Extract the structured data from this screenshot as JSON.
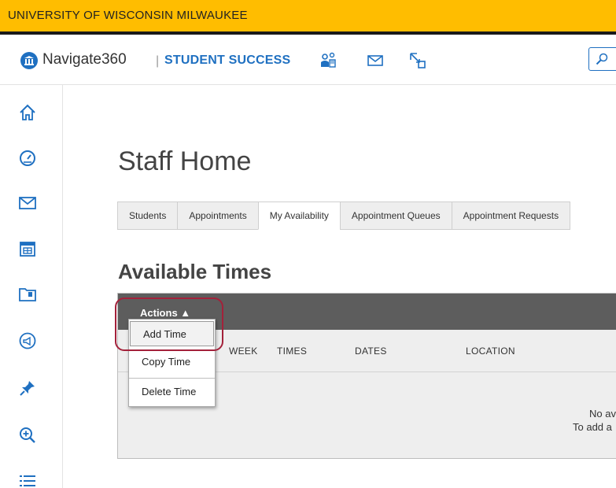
{
  "university_bar": {
    "name": "UNIVERSITY OF WISCONSIN MILWAUKEE",
    "color": "#ffbd00"
  },
  "brand": {
    "name": "Navigate360",
    "separator": "|",
    "subtitle": "STUDENT SUCCESS",
    "accent": "#1f70c1"
  },
  "topnav_icons": [
    "people-icon",
    "mail-icon",
    "expand-icon",
    "search-icon"
  ],
  "sidebar": {
    "items": [
      {
        "icon": "home-icon"
      },
      {
        "icon": "dashboard-icon"
      },
      {
        "icon": "mail-icon"
      },
      {
        "icon": "calendar-icon"
      },
      {
        "icon": "folder-icon"
      },
      {
        "icon": "megaphone-icon"
      },
      {
        "icon": "pin-icon"
      },
      {
        "icon": "search-plus-icon"
      },
      {
        "icon": "list-icon"
      }
    ]
  },
  "page": {
    "title": "Staff Home"
  },
  "tabs": [
    {
      "label": "Students",
      "active": false
    },
    {
      "label": "Appointments",
      "active": false
    },
    {
      "label": "My Availability",
      "active": true
    },
    {
      "label": "Appointment Queues",
      "active": false
    },
    {
      "label": "Appointment Requests",
      "active": false
    }
  ],
  "section": {
    "title": "Available Times"
  },
  "table": {
    "actions_label": "Actions ▲",
    "columns": [
      "WEEK",
      "TIMES",
      "DATES",
      "LOCATION"
    ],
    "empty_line1": "No av",
    "empty_line2": "To add a"
  },
  "actions_menu": {
    "items": [
      "Add Time",
      "Copy Time",
      "Delete Time"
    ],
    "highlight_color": "#a3213a"
  }
}
